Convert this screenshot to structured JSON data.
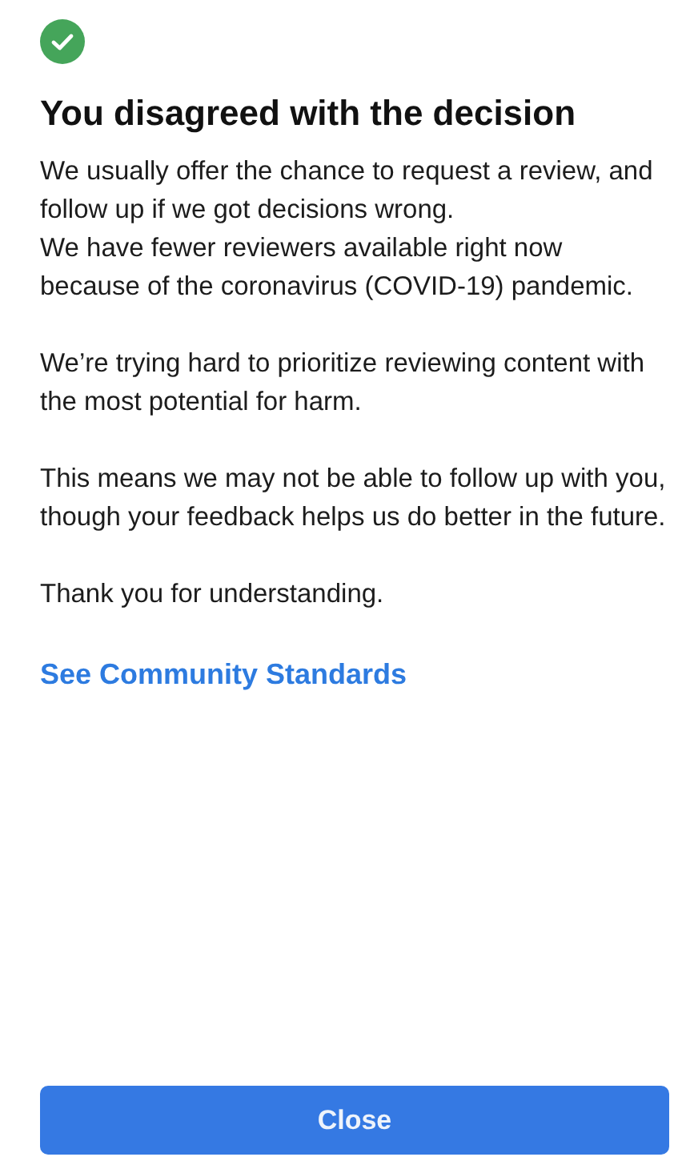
{
  "status": {
    "kind": "success"
  },
  "title": "You disagreed with the decision",
  "paragraphs": [
    "We usually offer the chance to request a review, and follow up if we got decisions wrong.\nWe have fewer reviewers available right now because of the coronavirus (COVID-19) pandemic.",
    "We’re trying hard to prioritize reviewing content with the most potential for harm.",
    "This means we may not be able to follow up with you, though your feedback helps us do better in the future.",
    "Thank you for understanding."
  ],
  "link": "See Community Standards",
  "button": "Close"
}
